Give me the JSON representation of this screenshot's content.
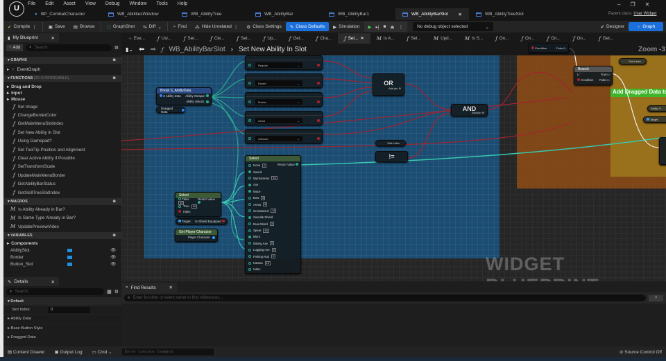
{
  "menu": [
    "File",
    "Edit",
    "Asset",
    "View",
    "Debug",
    "Window",
    "Tools",
    "Help"
  ],
  "doc_tabs": [
    {
      "label": "BP_CombatCharacter"
    },
    {
      "label": "WB_AbilitiesWindow"
    },
    {
      "label": "WB_AbilityTree"
    },
    {
      "label": "WB_AbilityBar"
    },
    {
      "label": "WB_AbilityBar1"
    },
    {
      "label": "WB_AbilityBarSlot",
      "active": true
    },
    {
      "label": "WB_AbilityTreeSlot"
    }
  ],
  "parent_class": {
    "label": "Parent class:",
    "value": "User Widget"
  },
  "toolbar": {
    "compile": "Compile",
    "save": "Save",
    "browse": "Browse",
    "graphshot": "GraphShot",
    "diff": "Diff",
    "find": "Find",
    "hide_unrelated": "Hide Unrelated",
    "class_settings": "Class Settings",
    "class_defaults": "Class Defaults",
    "simulation": "Simulation",
    "debug_object": "No debug object selected",
    "designer": "Designer",
    "graph": "Graph"
  },
  "my_blueprint": {
    "tab": "My Blueprint",
    "add": "Add",
    "search_placeholder": "Search",
    "graphs_header": "GRAPHS",
    "event_graph": "EventGraph",
    "functions_header": "FUNCTIONS",
    "functions_count": "(29 OVERRIDABLE)",
    "function_categories": [
      "Drag and Drop",
      "Input",
      "Mouse"
    ],
    "functions": [
      "Set Image",
      "ChangeBorderColor",
      "GetMainMenuSlotIndex",
      "Set New Ability in Slot",
      "Using Gamepad?",
      "Set ToolTip Position and Alignment",
      "Clear Active Ability if Possible",
      "SetTransformScale",
      "UpdateMainMenuBorder",
      "GetAbilityBarStatus",
      "GetSkillTreeSlotIndex"
    ],
    "macros_header": "MACROS",
    "macros": [
      "Is Ability Already in Bar?",
      "Is Same Type Already in Bar?",
      "UpdatePreviewVideo"
    ],
    "variables_header": "VARIABLES",
    "variable_category": "Components",
    "variables": [
      "AbilitySlot",
      "Border",
      "Button_Slot"
    ]
  },
  "details": {
    "tab": "Details",
    "search_placeholder": "Search",
    "section": "Default",
    "slot_index_label": "Slot Index",
    "slot_index_value": "0",
    "rows": [
      "Ability Data",
      "Base Button Style",
      "Dragged Data"
    ]
  },
  "graph": {
    "tabs": [
      "Eve...",
      "Usi...",
      "Set...",
      "Cle...",
      "Set...",
      "Up...",
      "Get...",
      "Cha...",
      "Set...",
      "Is A...",
      "Set...",
      "Upd...",
      "Is S...",
      "On...",
      "On...",
      "On...",
      "On...",
      "Get..."
    ],
    "active_tab": 8,
    "breadcrumb_root": "WB_AbilityBarSlot",
    "breadcrumb_current": "Set New Ability In Slot",
    "zoom": "Zoom -3",
    "watermark": "WIDGET BLUEPRINT",
    "break_node": {
      "title": "Break S_AbilityData",
      "in": "S Ability Data",
      "out1": "Ability Weapon",
      "out2": "Ability Unlock"
    },
    "dragged_data": "Dragged Data",
    "enum_values": [
      "Regular",
      "Expert",
      "Master",
      "Aerial",
      "Ultimate"
    ],
    "or_label": "OR",
    "and_label": "AND",
    "add_pin": "Add pin",
    "neq": "!=",
    "slot_index": "Slot Index",
    "select_big": {
      "title": "Select",
      "return": "Return Value",
      "pins": [
        {
          "n": "None",
          "v": "0"
        },
        {
          "n": "Sword"
        },
        {
          "n": "Warhammer",
          "v": "14"
        },
        {
          "n": "Axe"
        },
        {
          "n": "Mace"
        },
        {
          "n": "Bow",
          "v": "6"
        },
        {
          "n": "Arrow",
          "v": "8"
        },
        {
          "n": "Greatsword",
          "v": "14"
        },
        {
          "n": "Sword& Shield"
        },
        {
          "n": "Dual Wield",
          "v": "3"
        },
        {
          "n": "Spear",
          "v": "44"
        },
        {
          "n": "Blunt"
        },
        {
          "n": "Mining Axe",
          "v": "0"
        },
        {
          "n": "Logging Axe",
          "v": "0"
        },
        {
          "n": "Fishing Rod",
          "v": "0"
        },
        {
          "n": "Katana",
          "v": "10"
        },
        {
          "n": "Index"
        }
      ]
    },
    "select_small": {
      "title": "Select",
      "false": "False",
      "false_v": "34",
      "true": "True",
      "true_v": "24",
      "index": "Index",
      "return": "Return Value"
    },
    "shield_node": {
      "target": "Target",
      "out": "Is Shield Equipped"
    },
    "player_node": {
      "title": "Get Player Character",
      "out": "Player Character"
    },
    "cond_node": {
      "cond": "Condition",
      "false": "False"
    },
    "branch": {
      "title": "Branch",
      "cond": "Condition",
      "true": "True",
      "false": "False"
    },
    "banner": "Add Dragged Data to",
    "right_nodes": [
      "Slot Index",
      "Ability Tr",
      "Target"
    ]
  },
  "find": {
    "tab": "Find Results",
    "placeholder": "Enter function or event name to find references..."
  },
  "status": {
    "content_drawer": "Content Drawer",
    "output_log": "Output Log",
    "cmd": "Cmd",
    "console_placeholder": "Enter Console Command",
    "source_control": "Source Control Off"
  }
}
